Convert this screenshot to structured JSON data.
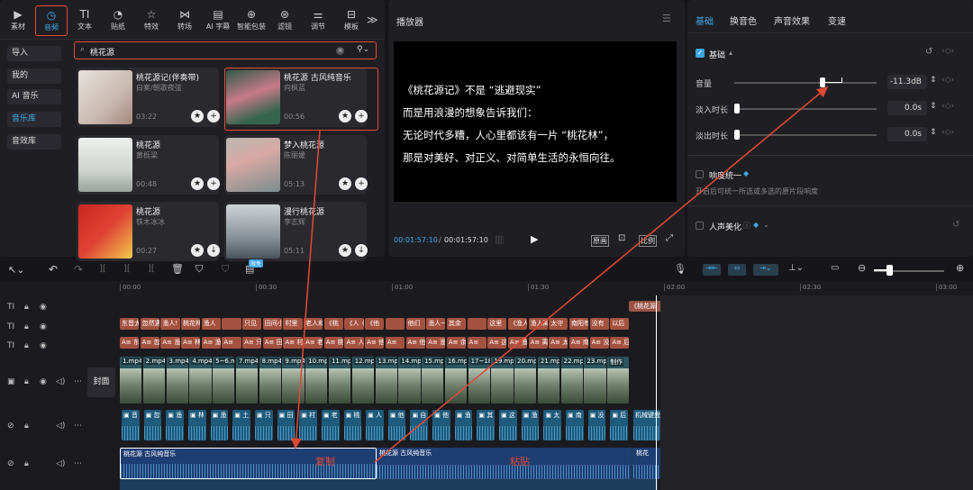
{
  "toolbar": {
    "items": [
      {
        "label": "素材",
        "icon": "media-icon"
      },
      {
        "label": "音频",
        "icon": "audio-icon"
      },
      {
        "label": "文本",
        "icon": "text-icon"
      },
      {
        "label": "贴纸",
        "icon": "sticker-icon"
      },
      {
        "label": "特效",
        "icon": "effect-icon"
      },
      {
        "label": "转场",
        "icon": "transition-icon"
      },
      {
        "label": "AI 字幕",
        "icon": "caption-icon"
      },
      {
        "label": "智能包装",
        "icon": "package-icon"
      },
      {
        "label": "滤镜",
        "icon": "filter-icon"
      },
      {
        "label": "调节",
        "icon": "adjust-icon"
      },
      {
        "label": "模板",
        "icon": "template-icon"
      }
    ],
    "more": "≫"
  },
  "sidebar": {
    "items": [
      "导入",
      "我的",
      "AI 音乐",
      "音乐库",
      "音效库"
    ]
  },
  "search": {
    "value": "桃花源"
  },
  "cards": [
    {
      "title": "桃花源记(伴奏带)",
      "artist": "白案/朝歌夜弦",
      "duration": "03:22"
    },
    {
      "title": "桃花源 古风纯音乐",
      "artist": "向枫蓝",
      "duration": "00:56"
    },
    {
      "title": "桃花源",
      "artist": "黄栎梁",
      "duration": "00:48"
    },
    {
      "title": "梦入桃花源",
      "artist": "陈丽媛",
      "duration": "05:13"
    },
    {
      "title": "桃花源",
      "artist": "铁木冰冰",
      "duration": "00:27"
    },
    {
      "title": "漫行桃花源",
      "artist": "李志辉",
      "duration": "05:11"
    }
  ],
  "player": {
    "title": "播放器",
    "subtitle_lines": [
      "《桃花源记》不是 “逃避现实”",
      "而是用浪漫的想象告诉我们：",
      "无论时代多糟，人心里都该有一片 “桃花林”，",
      "那是对美好、对正义、对简单生活的永恒向往。"
    ],
    "time_current": "00:01:57:10",
    "time_total": "00:01:57:10",
    "btn_original": "原画",
    "btn_ratio": "比例"
  },
  "props": {
    "tabs": [
      "基础",
      "换音色",
      "声音效果",
      "变速"
    ],
    "section": "基础",
    "volume_label": "音量",
    "volume_value": "-11.3dB",
    "volume_level": 0.62,
    "fadein_label": "淡入时长",
    "fadein_value": "0.0s",
    "fadeout_label": "淡出时长",
    "fadeout_value": "0.0s",
    "loudness_label": "响度统一",
    "loudness_desc": "开启后可统一所选或多选的原片段响度",
    "voice_label": "人声美化"
  },
  "timeline": {
    "free_badge": "限免",
    "ruler": [
      "00:00",
      "00:30",
      "01:00",
      "01:30",
      "02:00",
      "02:30",
      "03:00"
    ],
    "cover_label": "封面",
    "text_top": "《桃花源",
    "subtitle_clips": [
      "东晋太",
      "忽然遇",
      "渔人!",
      "桃花林",
      "渔人",
      "",
      "只见",
      "田间小",
      "村里",
      "老人和",
      "《桃",
      "《人《",
      "《他",
      "",
      "他们",
      "渔人一",
      "其余",
      "",
      "这里",
      "《渔人",
      "渔人离",
      "太守",
      "南阳有",
      "没有",
      "以后"
    ],
    "tts_clips": [
      "A≡ 东",
      "A≡ 忽",
      "A≡ 渔",
      "A≡ 林",
      "A≡ 渔",
      "A≡",
      "A≡ 只",
      "A≡ 田",
      "A≡ 村",
      "A≡ 老",
      "A≡ 桃",
      "A≡ 人",
      "A≡ 他",
      "A≡",
      "A≡ 他",
      "A≡ 渔",
      "A≡ 余",
      "A≡",
      "A≡ 这",
      "A≡ 渔",
      "A≡ 离",
      "A≡ 太",
      "A≡ 南",
      "A≡ 没",
      "A≡ 后"
    ],
    "video_clips": [
      "1.mp4",
      "2.mp4",
      "3.mp4",
      "4.mp4",
      "5~6.m",
      "7.mp4",
      "8.mp4",
      "9.mp4",
      "10.mp",
      "11.mp",
      "12.mp",
      "13.mp",
      "14.mp",
      "15.mp",
      "16.mp",
      "17~18",
      "19.mp",
      "20.mp",
      "21.mp",
      "22.mp",
      "23.mp",
      "制作"
    ],
    "voice_clips": [
      "▣ 音",
      "▣ 忽",
      "▣ 渔",
      "▣ 林",
      "▣ 渔",
      "▣ 土",
      "▣ 只",
      "▣ 田",
      "▣ 村",
      "▣ 老",
      "▣ 桃",
      "▣ 人",
      "▣ 他",
      "▣ 自",
      "▣ 他",
      "▣ 渔",
      "▣ 其",
      "▣ 这",
      "▣ 渔",
      "▣ 太",
      "▣ 南",
      "▣ 没",
      "▣ 后"
    ],
    "keyboard_clip": "机械键盘",
    "music_clips": [
      "桃花源 古风纯音乐",
      "桃花源 古风纯音乐",
      "桃花"
    ],
    "annotation_copy": "复制",
    "annotation_paste": "粘贴"
  }
}
